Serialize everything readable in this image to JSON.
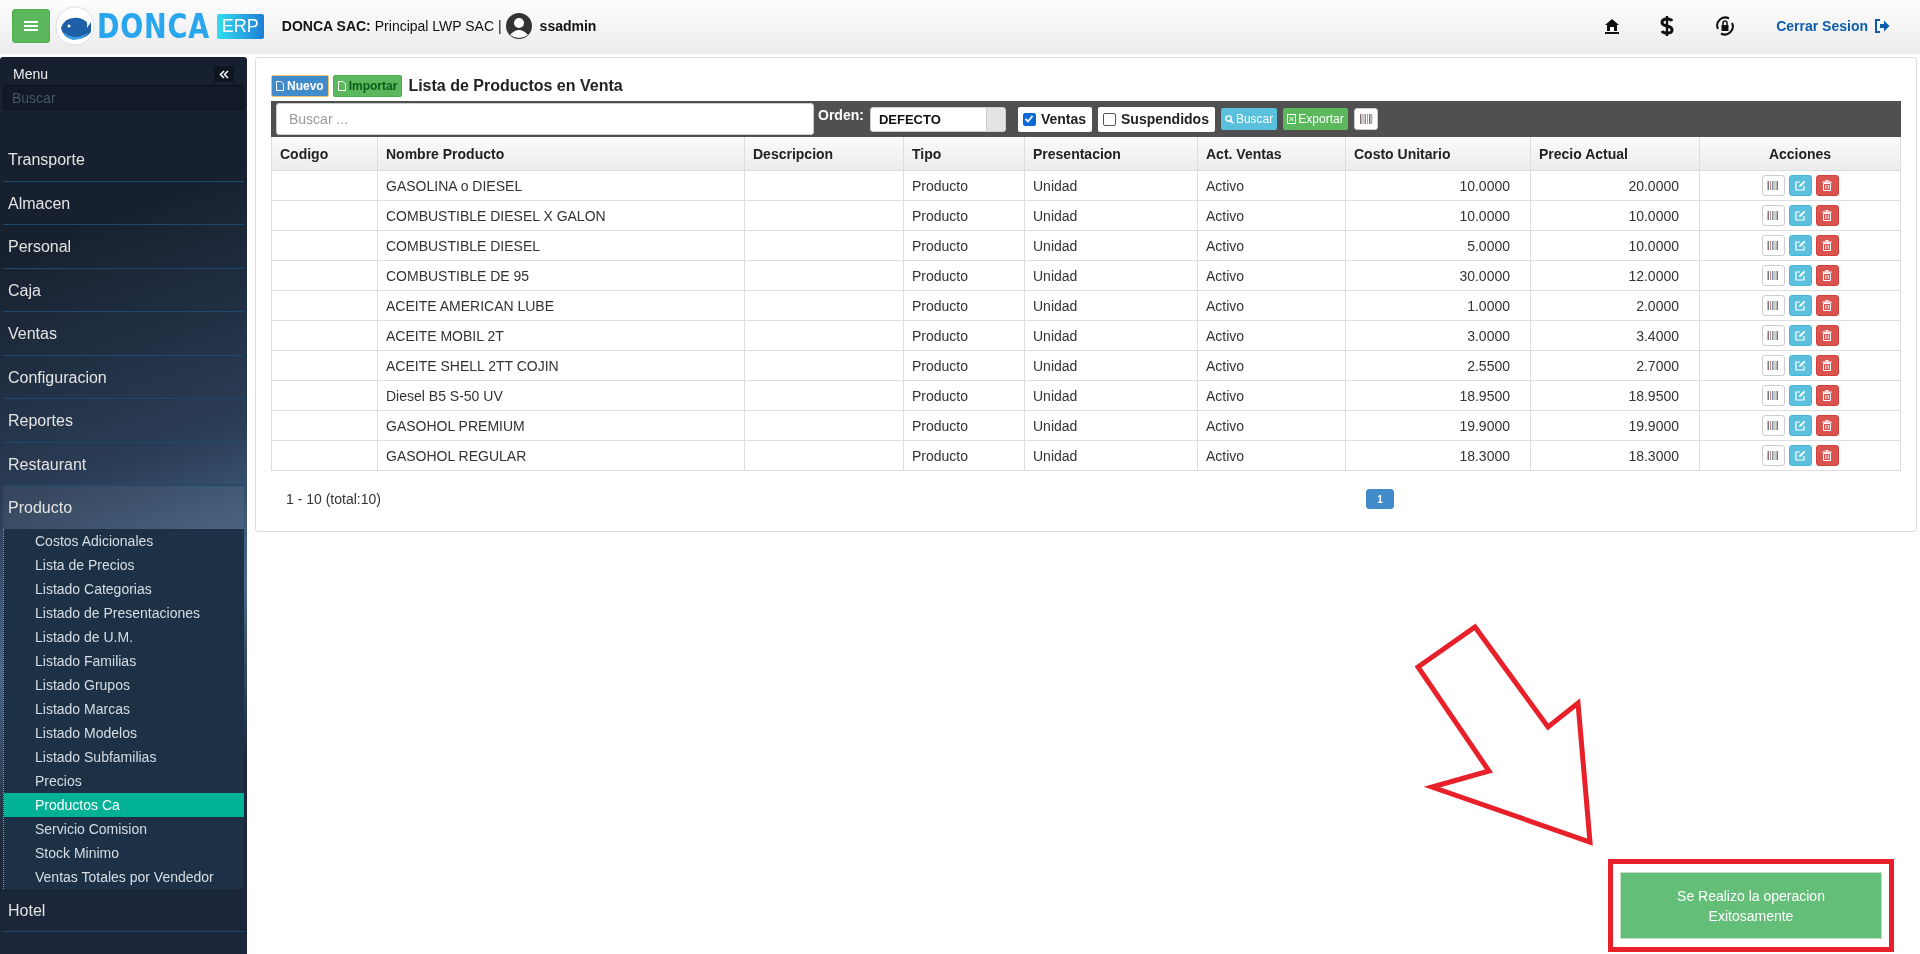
{
  "header": {
    "logo_text": "DONCA",
    "logo_badge": "ERP",
    "company_label": "DONCA SAC:",
    "company": "Principal LWP SAC |",
    "user": "ssadmin",
    "logout": "Cerrar Sesion"
  },
  "sidebar": {
    "title": "Menu",
    "search": {
      "placeholder": "Buscar"
    },
    "items": [
      {
        "label": "Transporte",
        "expanded": false
      },
      {
        "label": "Almacen",
        "expanded": false
      },
      {
        "label": "Personal",
        "expanded": false
      },
      {
        "label": "Caja",
        "expanded": false
      },
      {
        "label": "Ventas",
        "expanded": false
      },
      {
        "label": "Configuracion",
        "expanded": false
      },
      {
        "label": "Reportes",
        "expanded": false
      },
      {
        "label": "Restaurant",
        "expanded": false
      },
      {
        "label": "Producto",
        "expanded": true,
        "children": [
          {
            "label": "Costos Adicionales",
            "selected": false
          },
          {
            "label": "Lista de Precios",
            "selected": false
          },
          {
            "label": "Listado Categorias",
            "selected": false
          },
          {
            "label": "Listado de Presentaciones",
            "selected": false
          },
          {
            "label": "Listado de U.M.",
            "selected": false
          },
          {
            "label": "Listado Familias",
            "selected": false
          },
          {
            "label": "Listado Grupos",
            "selected": false
          },
          {
            "label": "Listado Marcas",
            "selected": false
          },
          {
            "label": "Listado Modelos",
            "selected": false
          },
          {
            "label": "Listado Subfamilias",
            "selected": false
          },
          {
            "label": "Precios",
            "selected": false
          },
          {
            "label": "Productos Ca",
            "selected": true
          },
          {
            "label": "Servicio Comision",
            "selected": false
          },
          {
            "label": "Stock Minimo",
            "selected": false
          },
          {
            "label": "Ventas Totales por Vendedor",
            "selected": false
          }
        ]
      },
      {
        "label": "Hotel",
        "expanded": false
      }
    ]
  },
  "panel": {
    "new_button": "Nuevo",
    "import_button": "Importar",
    "title": "Lista de Productos en Venta",
    "filters": {
      "search": {
        "placeholder": "Buscar ..."
      },
      "order_label": "Orden:",
      "order_value": "DEFECTO",
      "checks": [
        {
          "label": "Ventas",
          "checked": true
        },
        {
          "label": "Suspendidos",
          "checked": false
        }
      ],
      "search_button": "Buscar",
      "export_button": "Exportar"
    },
    "table": {
      "columns": [
        "Codigo",
        "Nombre Producto",
        "Descripcion",
        "Tipo",
        "Presentacion",
        "Act. Ventas",
        "Costo Unitario",
        "Precio Actual",
        "Acciones"
      ],
      "rows": [
        [
          "",
          "GASOLINA o DIESEL",
          "",
          "Producto",
          "Unidad",
          "Activo",
          "10.0000",
          "20.0000"
        ],
        [
          "",
          "COMBUSTIBLE DIESEL X GALON",
          "",
          "Producto",
          "Unidad",
          "Activo",
          "10.0000",
          "10.0000"
        ],
        [
          "",
          "COMBUSTIBLE DIESEL",
          "",
          "Producto",
          "Unidad",
          "Activo",
          "5.0000",
          "10.0000"
        ],
        [
          "",
          "COMBUSTIBLE DE 95",
          "",
          "Producto",
          "Unidad",
          "Activo",
          "30.0000",
          "12.0000"
        ],
        [
          "",
          "ACEITE AMERICAN LUBE",
          "",
          "Producto",
          "Unidad",
          "Activo",
          "1.0000",
          "2.0000"
        ],
        [
          "",
          "ACEITE MOBIL 2T",
          "",
          "Producto",
          "Unidad",
          "Activo",
          "3.0000",
          "3.4000"
        ],
        [
          "",
          "ACEITE SHELL 2TT COJIN",
          "",
          "Producto",
          "Unidad",
          "Activo",
          "2.5500",
          "2.7000"
        ],
        [
          "",
          "Diesel B5 S-50 UV",
          "",
          "Producto",
          "Unidad",
          "Activo",
          "18.9500",
          "18.9500"
        ],
        [
          "",
          "GASOHOL PREMIUM",
          "",
          "Producto",
          "Unidad",
          "Activo",
          "19.9000",
          "19.9000"
        ],
        [
          "",
          "GASOHOL REGULAR",
          "",
          "Producto",
          "Unidad",
          "Activo",
          "18.3000",
          "18.3000"
        ]
      ]
    },
    "pagination": {
      "info": "1 - 10 (total:10)",
      "pages": [
        {
          "label": "1",
          "selected": true
        }
      ]
    }
  },
  "toast": {
    "message": "Se Realizo la operacion Exitosamente"
  }
}
